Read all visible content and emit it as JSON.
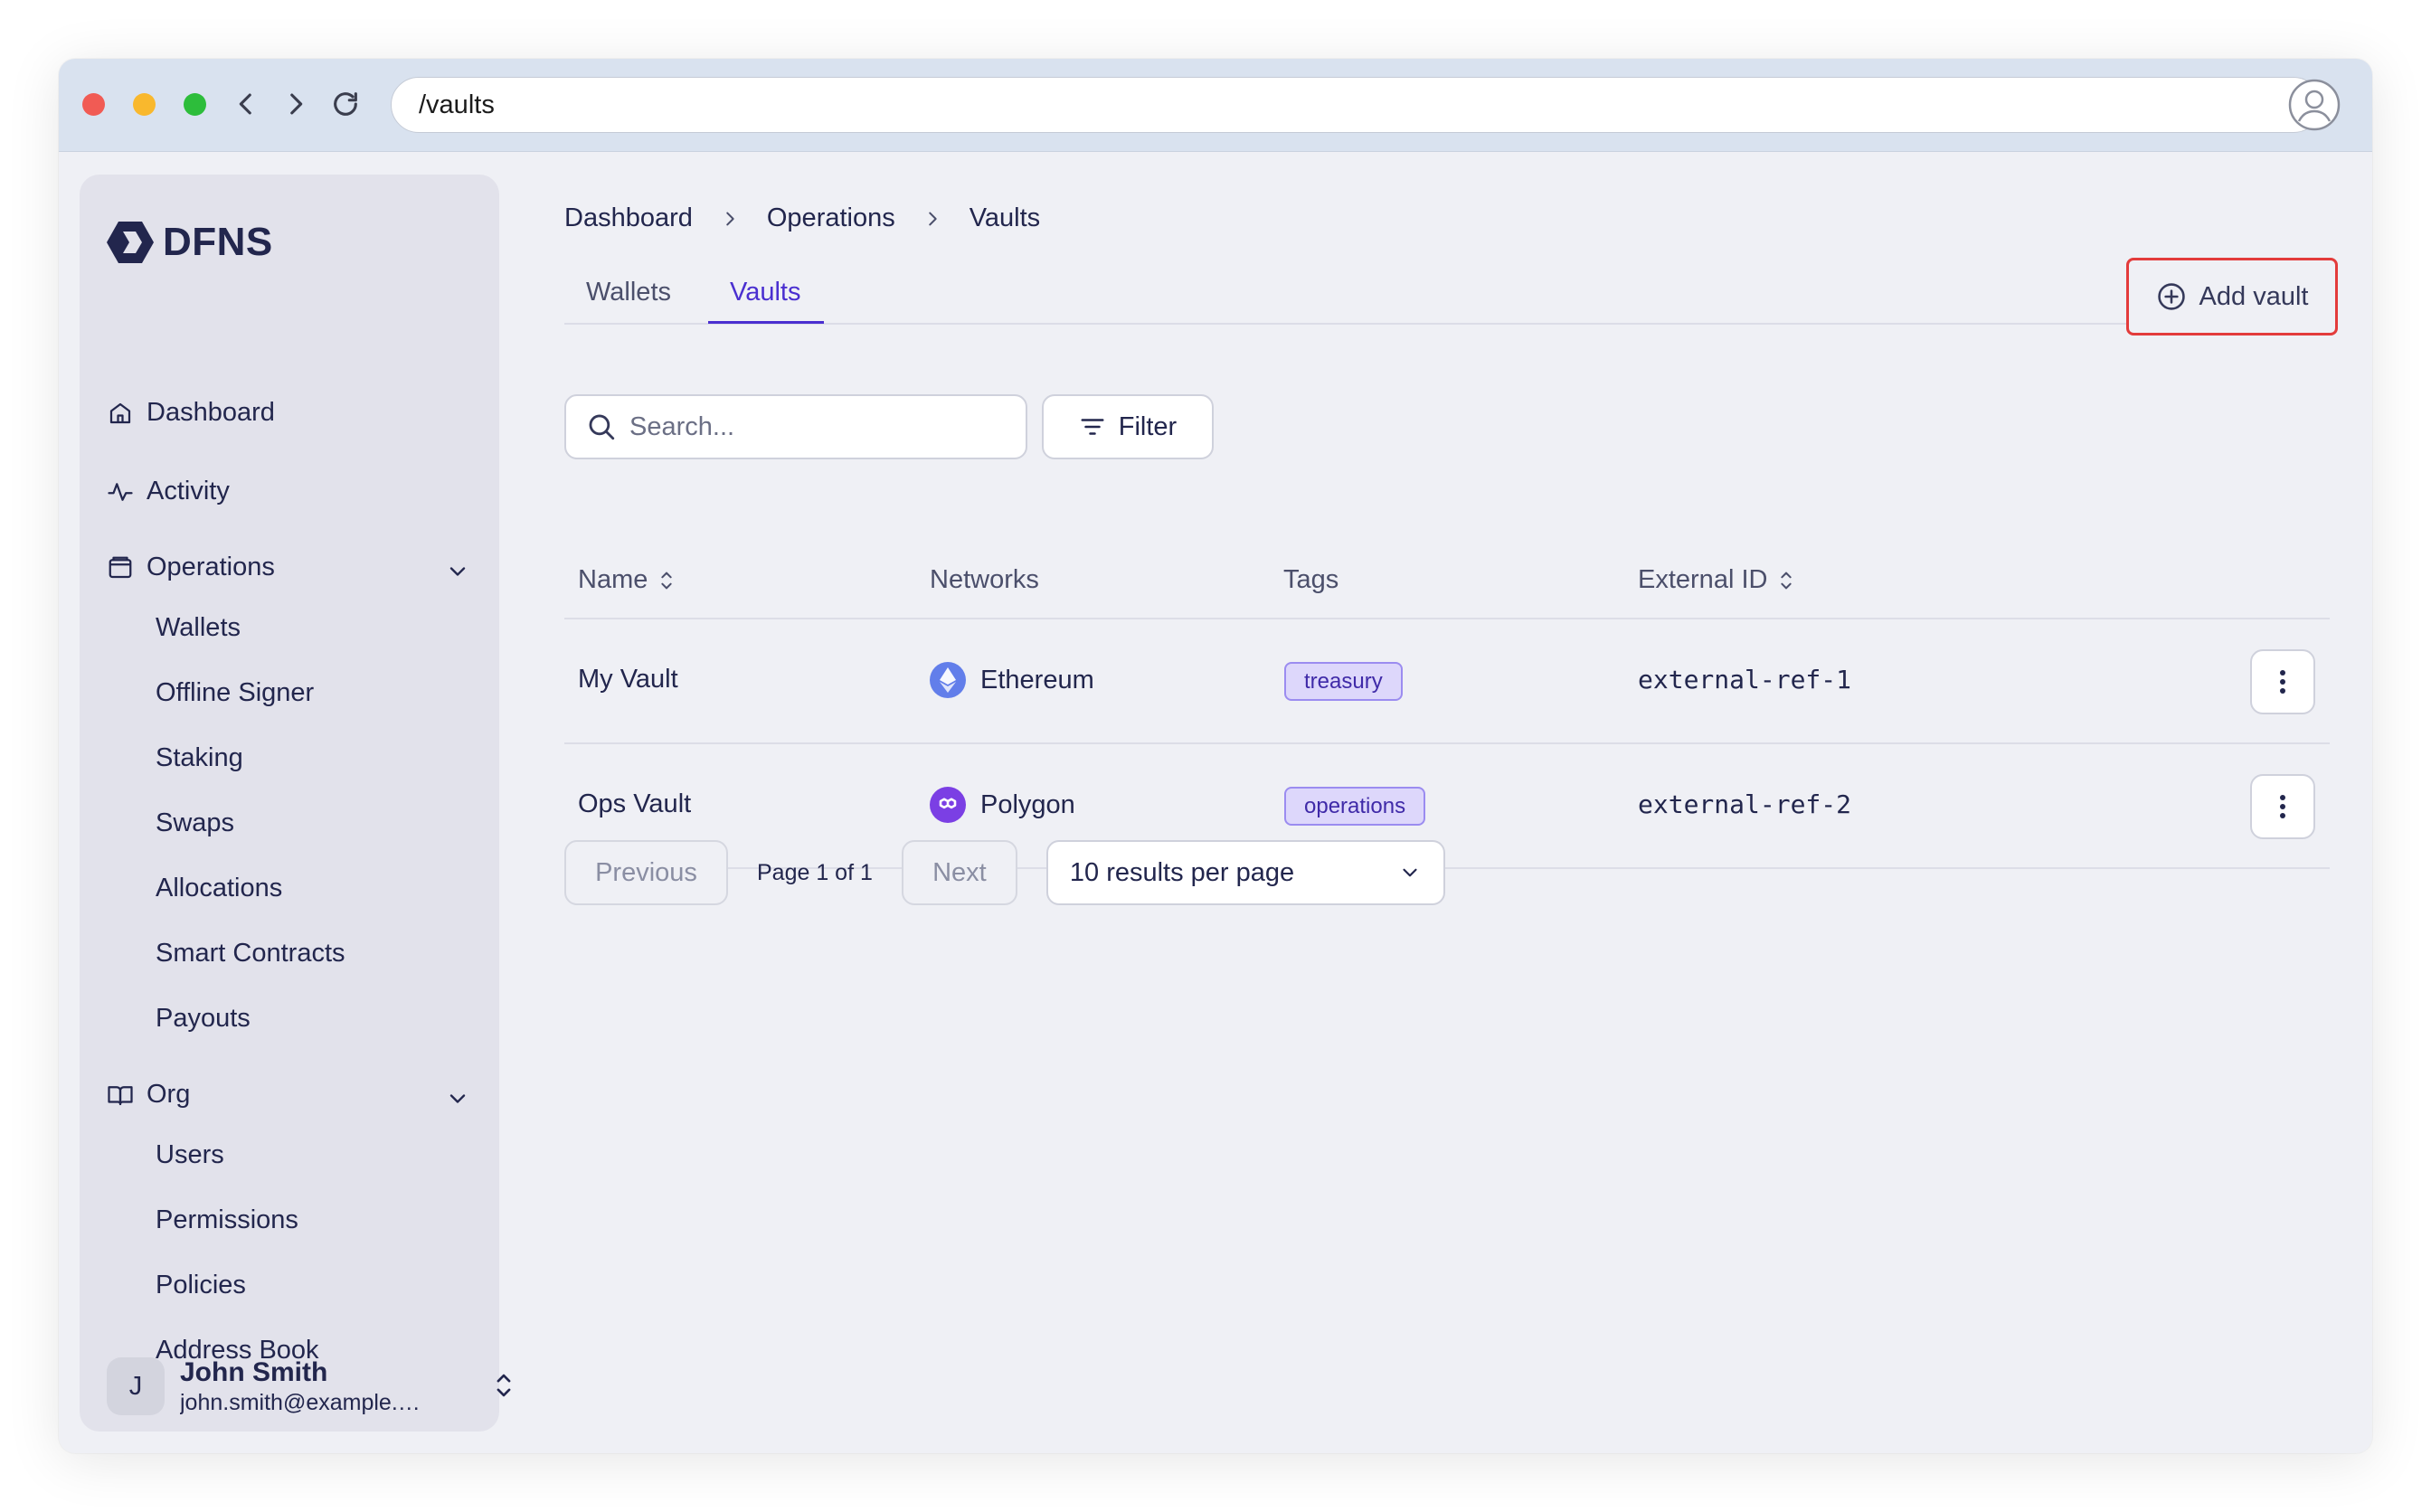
{
  "browser": {
    "url": "/vaults",
    "back_icon": "chevron-left-icon",
    "forward_icon": "chevron-right-icon",
    "reload_icon": "reload-icon",
    "profile_icon": "user-circle-icon"
  },
  "sidebar": {
    "logo_text": "DFNS",
    "items": [
      {
        "label": "Dashboard",
        "icon": "home-icon"
      },
      {
        "label": "Activity",
        "icon": "activity-icon"
      },
      {
        "label": "Operations",
        "icon": "wallet-icon",
        "expanded": true,
        "children": [
          "Wallets",
          "Offline Signer",
          "Staking",
          "Swaps",
          "Allocations",
          "Smart Contracts",
          "Payouts"
        ]
      },
      {
        "label": "Org",
        "icon": "book-icon",
        "expanded": true,
        "children": [
          "Users",
          "Permissions",
          "Policies",
          "Address Book"
        ]
      }
    ],
    "user": {
      "initial": "J",
      "name": "John Smith",
      "email": "john.smith@example.c..."
    }
  },
  "breadcrumb": [
    "Dashboard",
    "Operations",
    "Vaults"
  ],
  "tabs": [
    {
      "label": "Wallets",
      "active": false
    },
    {
      "label": "Vaults",
      "active": true
    }
  ],
  "add_button": {
    "label": "Add vault"
  },
  "search": {
    "placeholder": "Search..."
  },
  "filter": {
    "label": "Filter"
  },
  "table": {
    "columns": [
      {
        "label": "Name",
        "sortable": true
      },
      {
        "label": "Networks",
        "sortable": false
      },
      {
        "label": "Tags",
        "sortable": false
      },
      {
        "label": "External ID",
        "sortable": true
      }
    ],
    "rows": [
      {
        "name": "My Vault",
        "network": "Ethereum",
        "network_icon": "ethereum-icon",
        "tag": "treasury",
        "external_id": "external-ref-1"
      },
      {
        "name": "Ops Vault",
        "network": "Polygon",
        "network_icon": "polygon-icon",
        "tag": "operations",
        "external_id": "external-ref-2"
      }
    ]
  },
  "pagination": {
    "previous": "Previous",
    "page_text": "Page 1 of 1",
    "next": "Next",
    "per_page": "10 results per page"
  },
  "colors": {
    "accent": "#4a2fd0",
    "highlight_border": "#e33b3b",
    "tag_bg": "#ddd7fb",
    "ethereum": "#627eea",
    "polygon": "#7b3fe4"
  }
}
